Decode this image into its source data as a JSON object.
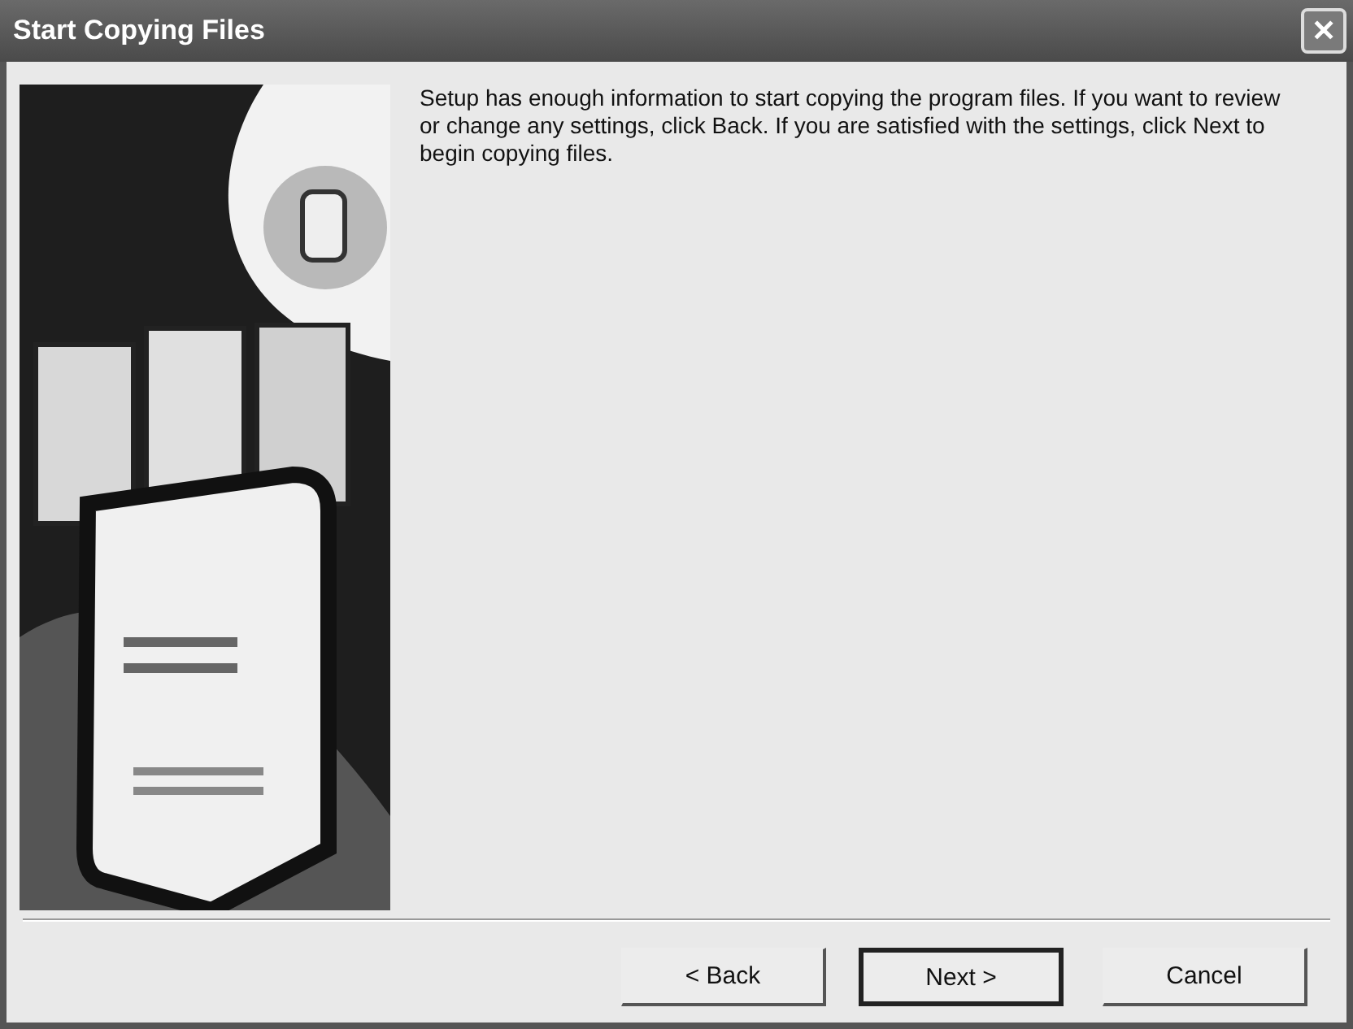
{
  "window": {
    "title": "Start Copying Files",
    "close_icon": "✕"
  },
  "message": "Setup has enough information to start copying the program files. If you want to review or change any settings, click Back.  If you are satisfied with the settings, click Next to begin copying files.",
  "buttons": [
    {
      "label": "< Back",
      "default": false
    },
    {
      "label": "Next >",
      "default": true
    },
    {
      "label": "Cancel",
      "default": false
    }
  ]
}
